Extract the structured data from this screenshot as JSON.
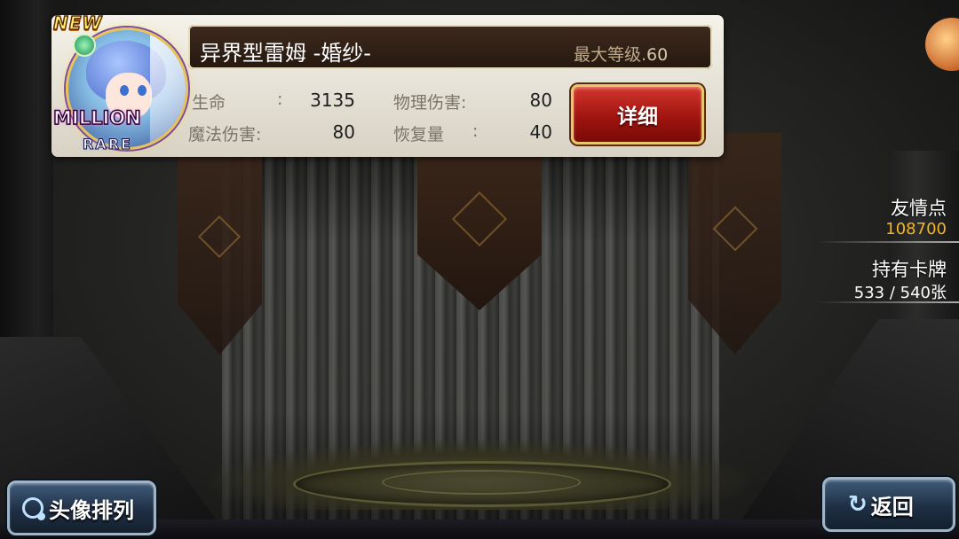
{
  "card": {
    "new_badge": "NEW",
    "rarity_top": "MILLION",
    "rarity_bottom": "RARE",
    "name": "异界型雷姆 -婚纱-",
    "max_level_label": "最大等级.",
    "max_level_value": "60",
    "stats": {
      "hp_label": "生命",
      "hp_value": "3135",
      "phys_label": "物理伤害:",
      "phys_value": "80",
      "magic_label": "魔法伤害:",
      "magic_value": "80",
      "heal_label": "恢复量",
      "heal_value": "40",
      "sep": ":"
    },
    "detail_button": "详细"
  },
  "sidebar": {
    "friend_points_label": "友情点",
    "friend_points_value": "108700",
    "cards_label": "持有卡牌",
    "cards_value": "533 / 540张"
  },
  "buttons": {
    "sort_label": "头像排列",
    "back_label": "返回",
    "back_icon": "↻"
  },
  "colors": {
    "friend_points": "#f2b626",
    "detail_button": "#b01d17",
    "bottom_button": "#2a3f57"
  }
}
